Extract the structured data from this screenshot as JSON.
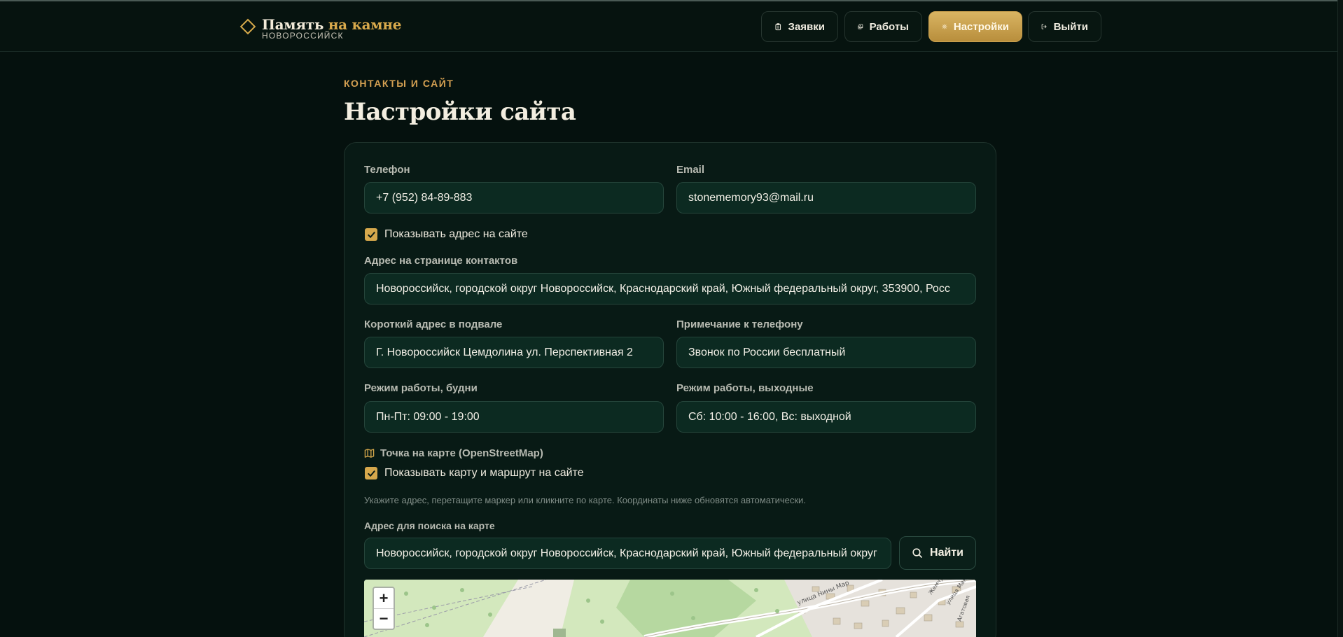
{
  "header": {
    "logo_title_main": "Память",
    "logo_title_accent": "на камне",
    "logo_subtitle": "НОВОРОССИЙСК",
    "nav": {
      "requests": "Заявки",
      "works": "Работы",
      "settings": "Настройки",
      "logout": "Выйти"
    }
  },
  "page": {
    "eyebrow": "КОНТАКТЫ И САЙТ",
    "title": "Настройки сайта"
  },
  "form": {
    "phone_label": "Телефон",
    "phone_value": "+7 (952) 84-89-883",
    "email_label": "Email",
    "email_value": "stonememory93@mail.ru",
    "show_address_label": "Показывать адрес на сайте",
    "show_address_checked": true,
    "contact_address_label": "Адрес на странице контактов",
    "contact_address_value": "Новороссийск, городской округ Новороссийск, Краснодарский край, Южный федеральный округ, 353900, Росс",
    "footer_address_label": "Короткий адрес в подвале",
    "footer_address_value": "Г. Новороссийск Цемдолина ул. Перспективная 2",
    "phone_note_label": "Примечание к телефону",
    "phone_note_value": "Звонок по России бесплатный",
    "weekdays_label": "Режим работы, будни",
    "weekdays_value": "Пн-Пт: 09:00 - 19:00",
    "weekend_label": "Режим работы, выходные",
    "weekend_value": "Сб: 10:00 - 16:00, Вс: выходной",
    "map_section_title": "Точка на карте (OpenStreetMap)",
    "show_map_label": "Показывать карту и маршрут на сайте",
    "show_map_checked": true,
    "map_hint": "Укажите адрес, перетащите маркер или кликните по карте. Координаты ниже обновятся автоматически.",
    "map_search_label": "Адрес для поиска на карте",
    "map_search_value": "Новороссийск, городской округ Новороссийск, Краснодарский край, Южный федеральный округ",
    "find_button": "Найти"
  },
  "map": {
    "zoom_in": "+",
    "zoom_out": "−",
    "street_1": "улица Нины Мар",
    "street_2": "Жемчужная",
    "street_3": "улица Маяка",
    "street_4": "Агатовая"
  },
  "colors": {
    "background": "#05110e",
    "accent": "#d6a84c",
    "card": "#081a15",
    "field": "#0c2a21"
  }
}
